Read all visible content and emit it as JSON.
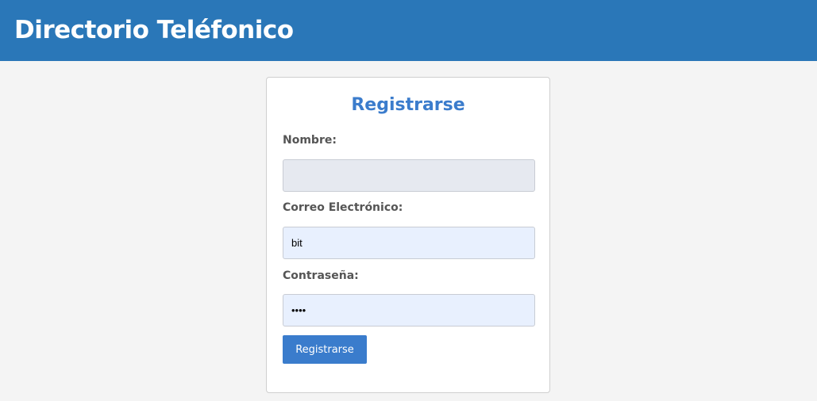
{
  "header": {
    "title": "Directorio Teléfonico",
    "background_color": "#2a77b8"
  },
  "form": {
    "title": "Registrarse",
    "title_color": "#3b7ccc",
    "fields": [
      {
        "label": "Nombre:",
        "value": "",
        "type": "text"
      },
      {
        "label": "Correo Electrónico:",
        "value": "bit",
        "type": "email"
      },
      {
        "label": "Contraseña:",
        "value": "bitx",
        "type": "password"
      }
    ],
    "submit_label": "Registrarse",
    "submit_color": "#3a7ccc"
  },
  "page": {
    "background_color": "#f4f4f4"
  }
}
